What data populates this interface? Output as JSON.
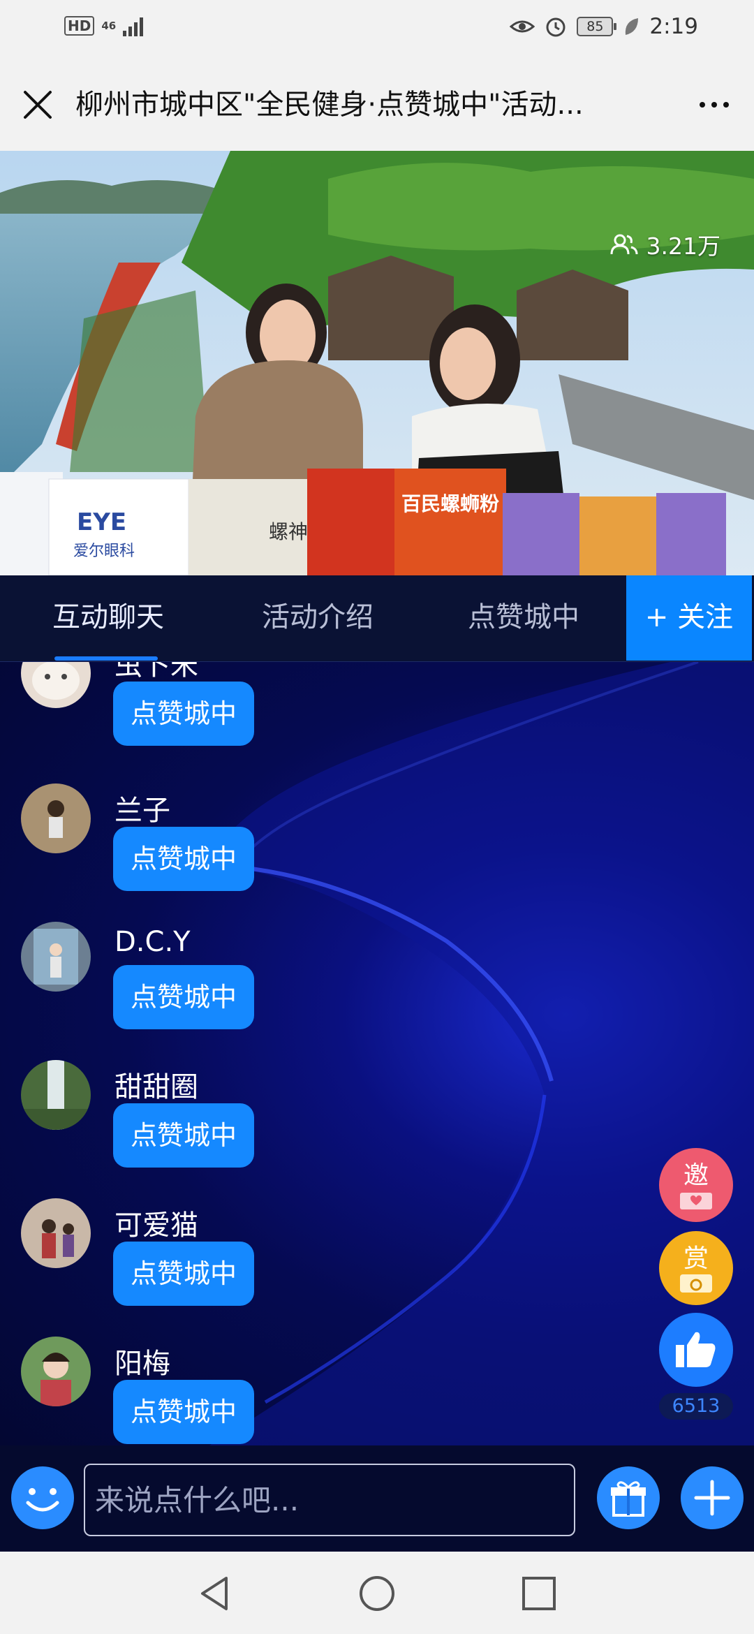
{
  "status_bar": {
    "hd": "HD",
    "network": "46",
    "battery": "85",
    "time": "2:19",
    "icons": [
      "eye-icon",
      "alarm-icon",
      "leaf-icon"
    ]
  },
  "title_bar": {
    "title": "柳州市城中区\"全民健身·点赞城中\"活动..."
  },
  "video": {
    "viewer_count": "3.21万",
    "product_labels": [
      "EYE",
      "爱尔眼科",
      "螺神",
      "百民螺蛳粉"
    ]
  },
  "tabs": {
    "items": [
      "互动聊天",
      "活动介绍",
      "点赞城中"
    ],
    "active_index": 0,
    "follow": "+ 关注"
  },
  "chat": {
    "messages": [
      {
        "name": "虫卜米",
        "text": "点赞城中"
      },
      {
        "name": "兰子",
        "text": "点赞城中"
      },
      {
        "name": "D.C.Y",
        "text": "点赞城中"
      },
      {
        "name": "甜甜圈",
        "text": "点赞城中"
      },
      {
        "name": "可爱猫",
        "text": "点赞城中"
      },
      {
        "name": "阳梅",
        "text": "点赞城中"
      }
    ]
  },
  "floating": {
    "invite": "邀",
    "reward": "赏",
    "like_count": "6513"
  },
  "input_bar": {
    "placeholder": "来说点什么吧..."
  },
  "colors": {
    "accent": "#0a86ff",
    "chat_bg": "#050a52",
    "invite": "#f05a6e",
    "reward": "#f6b21a"
  }
}
